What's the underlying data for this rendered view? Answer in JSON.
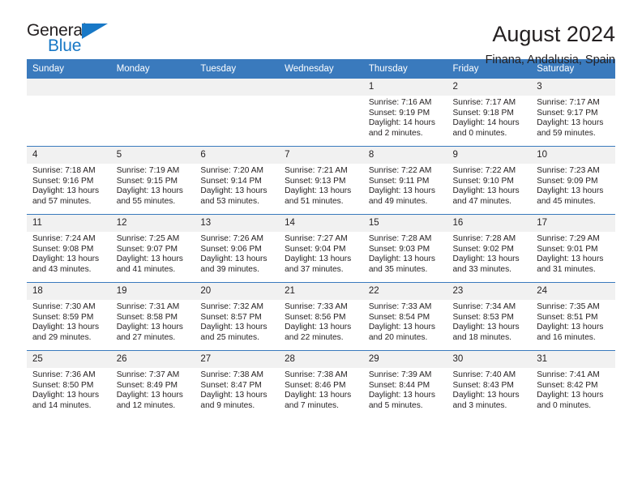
{
  "logo": {
    "word_one": "General",
    "word_two": "Blue",
    "triangle_color": "#1878c6"
  },
  "header": {
    "title": "August 2024",
    "subtitle": "Finana, Andalusia, Spain",
    "accent_color": "#3a7abd"
  },
  "weekday_headers": [
    "Sunday",
    "Monday",
    "Tuesday",
    "Wednesday",
    "Thursday",
    "Friday",
    "Saturday"
  ],
  "labels": {
    "sunrise_prefix": "Sunrise:",
    "sunset_prefix": "Sunset:",
    "daylight_prefix": "Daylight:"
  },
  "weeks": [
    [
      {
        "day": "",
        "empty": true
      },
      {
        "day": "",
        "empty": true
      },
      {
        "day": "",
        "empty": true
      },
      {
        "day": "",
        "empty": true
      },
      {
        "day": "1",
        "sunrise": "Sunrise: 7:16 AM",
        "sunset": "Sunset: 9:19 PM",
        "daylight": "Daylight: 14 hours and 2 minutes."
      },
      {
        "day": "2",
        "sunrise": "Sunrise: 7:17 AM",
        "sunset": "Sunset: 9:18 PM",
        "daylight": "Daylight: 14 hours and 0 minutes."
      },
      {
        "day": "3",
        "sunrise": "Sunrise: 7:17 AM",
        "sunset": "Sunset: 9:17 PM",
        "daylight": "Daylight: 13 hours and 59 minutes."
      }
    ],
    [
      {
        "day": "4",
        "sunrise": "Sunrise: 7:18 AM",
        "sunset": "Sunset: 9:16 PM",
        "daylight": "Daylight: 13 hours and 57 minutes."
      },
      {
        "day": "5",
        "sunrise": "Sunrise: 7:19 AM",
        "sunset": "Sunset: 9:15 PM",
        "daylight": "Daylight: 13 hours and 55 minutes."
      },
      {
        "day": "6",
        "sunrise": "Sunrise: 7:20 AM",
        "sunset": "Sunset: 9:14 PM",
        "daylight": "Daylight: 13 hours and 53 minutes."
      },
      {
        "day": "7",
        "sunrise": "Sunrise: 7:21 AM",
        "sunset": "Sunset: 9:13 PM",
        "daylight": "Daylight: 13 hours and 51 minutes."
      },
      {
        "day": "8",
        "sunrise": "Sunrise: 7:22 AM",
        "sunset": "Sunset: 9:11 PM",
        "daylight": "Daylight: 13 hours and 49 minutes."
      },
      {
        "day": "9",
        "sunrise": "Sunrise: 7:22 AM",
        "sunset": "Sunset: 9:10 PM",
        "daylight": "Daylight: 13 hours and 47 minutes."
      },
      {
        "day": "10",
        "sunrise": "Sunrise: 7:23 AM",
        "sunset": "Sunset: 9:09 PM",
        "daylight": "Daylight: 13 hours and 45 minutes."
      }
    ],
    [
      {
        "day": "11",
        "sunrise": "Sunrise: 7:24 AM",
        "sunset": "Sunset: 9:08 PM",
        "daylight": "Daylight: 13 hours and 43 minutes."
      },
      {
        "day": "12",
        "sunrise": "Sunrise: 7:25 AM",
        "sunset": "Sunset: 9:07 PM",
        "daylight": "Daylight: 13 hours and 41 minutes."
      },
      {
        "day": "13",
        "sunrise": "Sunrise: 7:26 AM",
        "sunset": "Sunset: 9:06 PM",
        "daylight": "Daylight: 13 hours and 39 minutes."
      },
      {
        "day": "14",
        "sunrise": "Sunrise: 7:27 AM",
        "sunset": "Sunset: 9:04 PM",
        "daylight": "Daylight: 13 hours and 37 minutes."
      },
      {
        "day": "15",
        "sunrise": "Sunrise: 7:28 AM",
        "sunset": "Sunset: 9:03 PM",
        "daylight": "Daylight: 13 hours and 35 minutes."
      },
      {
        "day": "16",
        "sunrise": "Sunrise: 7:28 AM",
        "sunset": "Sunset: 9:02 PM",
        "daylight": "Daylight: 13 hours and 33 minutes."
      },
      {
        "day": "17",
        "sunrise": "Sunrise: 7:29 AM",
        "sunset": "Sunset: 9:01 PM",
        "daylight": "Daylight: 13 hours and 31 minutes."
      }
    ],
    [
      {
        "day": "18",
        "sunrise": "Sunrise: 7:30 AM",
        "sunset": "Sunset: 8:59 PM",
        "daylight": "Daylight: 13 hours and 29 minutes."
      },
      {
        "day": "19",
        "sunrise": "Sunrise: 7:31 AM",
        "sunset": "Sunset: 8:58 PM",
        "daylight": "Daylight: 13 hours and 27 minutes."
      },
      {
        "day": "20",
        "sunrise": "Sunrise: 7:32 AM",
        "sunset": "Sunset: 8:57 PM",
        "daylight": "Daylight: 13 hours and 25 minutes."
      },
      {
        "day": "21",
        "sunrise": "Sunrise: 7:33 AM",
        "sunset": "Sunset: 8:56 PM",
        "daylight": "Daylight: 13 hours and 22 minutes."
      },
      {
        "day": "22",
        "sunrise": "Sunrise: 7:33 AM",
        "sunset": "Sunset: 8:54 PM",
        "daylight": "Daylight: 13 hours and 20 minutes."
      },
      {
        "day": "23",
        "sunrise": "Sunrise: 7:34 AM",
        "sunset": "Sunset: 8:53 PM",
        "daylight": "Daylight: 13 hours and 18 minutes."
      },
      {
        "day": "24",
        "sunrise": "Sunrise: 7:35 AM",
        "sunset": "Sunset: 8:51 PM",
        "daylight": "Daylight: 13 hours and 16 minutes."
      }
    ],
    [
      {
        "day": "25",
        "sunrise": "Sunrise: 7:36 AM",
        "sunset": "Sunset: 8:50 PM",
        "daylight": "Daylight: 13 hours and 14 minutes."
      },
      {
        "day": "26",
        "sunrise": "Sunrise: 7:37 AM",
        "sunset": "Sunset: 8:49 PM",
        "daylight": "Daylight: 13 hours and 12 minutes."
      },
      {
        "day": "27",
        "sunrise": "Sunrise: 7:38 AM",
        "sunset": "Sunset: 8:47 PM",
        "daylight": "Daylight: 13 hours and 9 minutes."
      },
      {
        "day": "28",
        "sunrise": "Sunrise: 7:38 AM",
        "sunset": "Sunset: 8:46 PM",
        "daylight": "Daylight: 13 hours and 7 minutes."
      },
      {
        "day": "29",
        "sunrise": "Sunrise: 7:39 AM",
        "sunset": "Sunset: 8:44 PM",
        "daylight": "Daylight: 13 hours and 5 minutes."
      },
      {
        "day": "30",
        "sunrise": "Sunrise: 7:40 AM",
        "sunset": "Sunset: 8:43 PM",
        "daylight": "Daylight: 13 hours and 3 minutes."
      },
      {
        "day": "31",
        "sunrise": "Sunrise: 7:41 AM",
        "sunset": "Sunset: 8:42 PM",
        "daylight": "Daylight: 13 hours and 0 minutes."
      }
    ]
  ]
}
